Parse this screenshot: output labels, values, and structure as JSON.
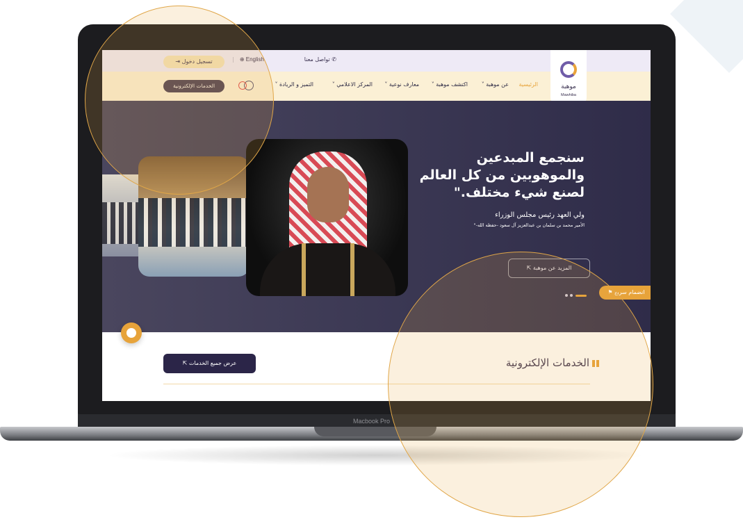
{
  "device": {
    "model_label": "Macbook Pro"
  },
  "topbar": {
    "contact_label": "تواصل معنا",
    "lang_label": "English",
    "login_label": "تسجيل دخول"
  },
  "logo": {
    "arabic": "موهبة",
    "english": "Mawhiba"
  },
  "nav": {
    "items": [
      {
        "label": "الرئيسية"
      },
      {
        "label": "عن موهبة"
      },
      {
        "label": "اكتشف موهبة"
      },
      {
        "label": "معارف نوعية"
      },
      {
        "label": "المركز الاعلامي"
      },
      {
        "label": "التميز و الريادة"
      }
    ],
    "eservices_label": "الخدمات الإلكترونية"
  },
  "hero": {
    "title_lines": [
      "سنجمع المبدعين",
      "والموهوبين من كل العالم",
      "لصنع شيء مختلف.\""
    ],
    "author": "ولي العهد رئيس مجلس الوزراء",
    "author_sub": "الأمير محمد بن سلمان بن عبدالعزيز آل سعود -حفظه الله-\"",
    "more_label": "المزيد عن موهبة",
    "join_label": "انضمام سريع"
  },
  "services": {
    "title": "الخدمات الإلكترونية",
    "all_label": "عرض جميع الخدمات"
  },
  "icons": [
    "phone-icon",
    "globe-icon",
    "login-icon",
    "search-icon",
    "accessibility-icon",
    "grid-icon",
    "chat-icon",
    "arrow-icon"
  ],
  "colors": {
    "accent": "#e7a33a",
    "primary": "#2b2548",
    "hero_bg": "#3d3a55",
    "nav_bg": "#fbf0d5"
  }
}
